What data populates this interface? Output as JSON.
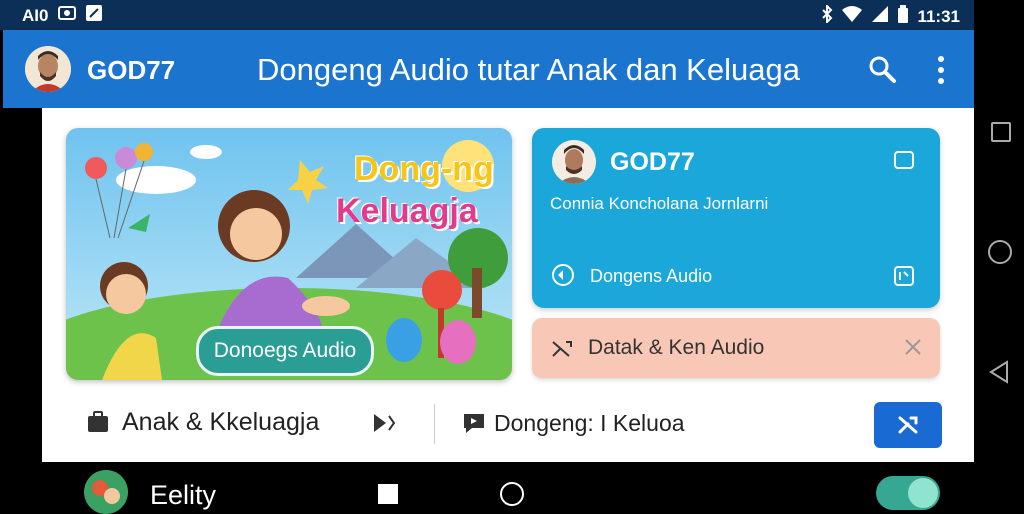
{
  "status_bar": {
    "left_text": "AI0",
    "time": "11:31",
    "icons": [
      "photo-icon",
      "edit-icon",
      "bluetooth-icon",
      "wifi-icon",
      "signal-icon",
      "battery-icon"
    ]
  },
  "app_bar": {
    "username": "GOD77",
    "title": "Dongeng Audio tutar Anak dan Keluaga",
    "icons": [
      "search-icon",
      "more-vert-icon"
    ],
    "color": "#1b75cf"
  },
  "hero": {
    "title_line1": "Dong-ng",
    "title_line2": "Keluagja",
    "button_label": "Donoegs Audio"
  },
  "profile_card": {
    "name": "GOD77",
    "subtitle": "Connia Koncholana Jornlarni",
    "audio_label": "Dongens Audio",
    "color": "#1ba7d9"
  },
  "audio_chip": {
    "label": "Datak & Ken Audio",
    "color": "#f9c7b6"
  },
  "bottom_row": {
    "label1": "Anak & Kkeluagja",
    "label2": "Dongeng: I Keluoa",
    "fab_color": "#1a6ad4"
  },
  "bottom_bar": {
    "label": "Eelity",
    "toggle_on": true
  }
}
